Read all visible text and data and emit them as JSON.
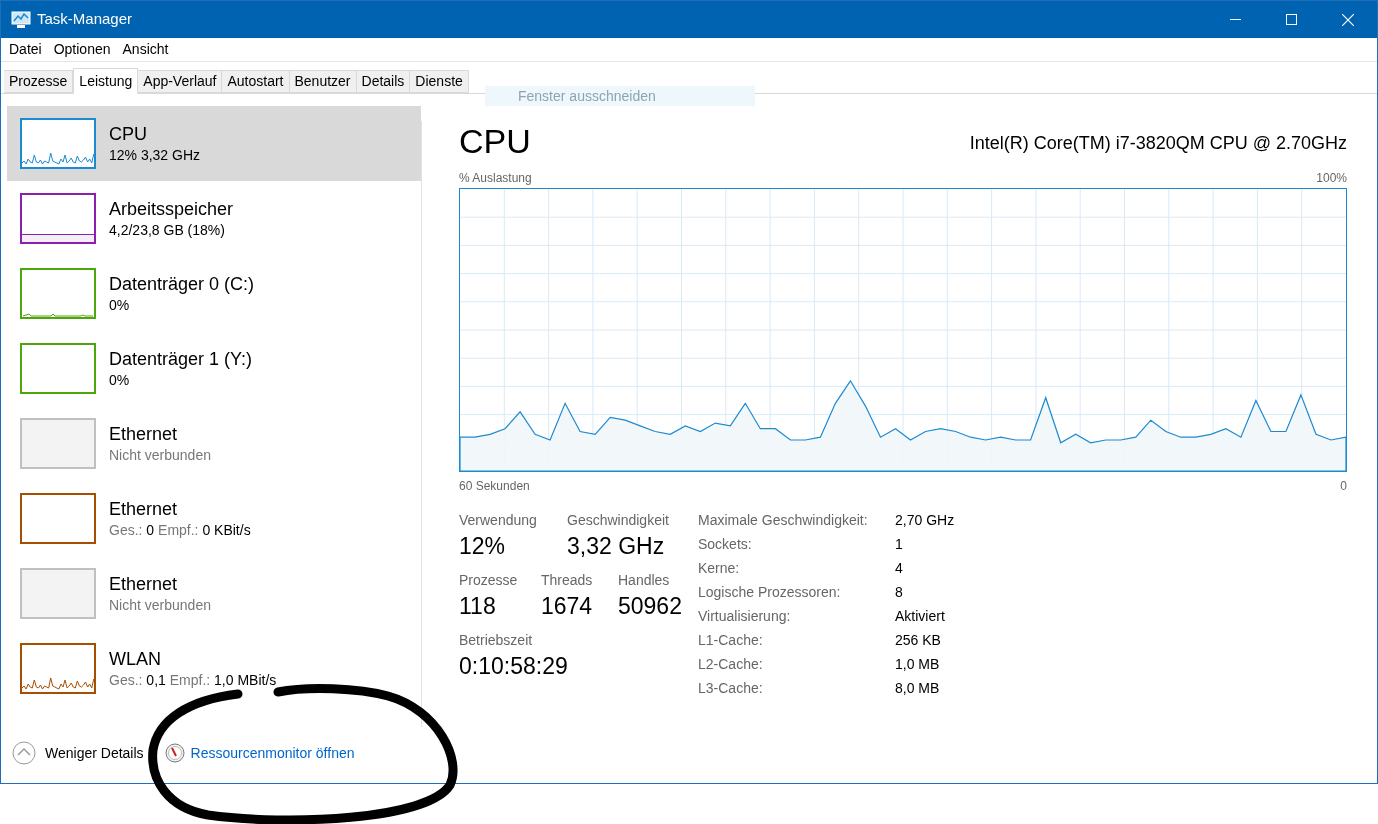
{
  "window": {
    "title": "Task-Manager"
  },
  "menu": [
    "Datei",
    "Optionen",
    "Ansicht"
  ],
  "tabs": [
    {
      "label": "Prozesse",
      "selected": false
    },
    {
      "label": "Leistung",
      "selected": true
    },
    {
      "label": "App-Verlauf",
      "selected": false
    },
    {
      "label": "Autostart",
      "selected": false
    },
    {
      "label": "Benutzer",
      "selected": false
    },
    {
      "label": "Details",
      "selected": false
    },
    {
      "label": "Dienste",
      "selected": false
    }
  ],
  "tooltip": "Fenster ausschneiden",
  "sidebar": {
    "items": [
      {
        "kind": "spark",
        "name": "CPU",
        "detail": "12%  3,32 GHz",
        "color": "#1c8ad0",
        "selected": true
      },
      {
        "kind": "fill",
        "name": "Arbeitsspeicher",
        "detail": "4,2/23,8 GB (18%)",
        "color": "#8b1fb0",
        "selected": false
      },
      {
        "kind": "flat",
        "name": "Datenträger 0 (C:)",
        "detail": "0%",
        "color": "#4da60c",
        "selected": false
      },
      {
        "kind": "empty",
        "name": "Datenträger 1 (Y:)",
        "detail": "0%",
        "color": "#4da60c",
        "selected": false
      },
      {
        "kind": "disconnected",
        "name": "Ethernet",
        "detail": "Nicht verbunden",
        "color": "#c0c0c0",
        "selected": false
      },
      {
        "kind": "empty",
        "name": "Ethernet",
        "detail_parts": [
          {
            "text": "Ges.:",
            "muted": true
          },
          {
            "text": "0",
            "muted": false
          },
          {
            "text": "Empf.:",
            "muted": true
          },
          {
            "text": "0 KBit/s",
            "muted": false
          }
        ],
        "color": "#a74f01",
        "selected": false
      },
      {
        "kind": "disconnected",
        "name": "Ethernet",
        "detail": "Nicht verbunden",
        "color": "#c0c0c0",
        "selected": false
      },
      {
        "kind": "spark",
        "name": "WLAN",
        "detail_parts": [
          {
            "text": "Ges.:",
            "muted": true
          },
          {
            "text": "0,1",
            "muted": false
          },
          {
            "text": "Empf.:",
            "muted": true
          },
          {
            "text": "1,0 MBit/s",
            "muted": false
          }
        ],
        "color": "#a74f01",
        "selected": false
      }
    ]
  },
  "main": {
    "title": "CPU",
    "model": "Intel(R) Core(TM) i7-3820QM CPU @ 2.70GHz",
    "graph": {
      "kind": "picture",
      "ylabel": "% Auslastung",
      "ymax_label": "100%",
      "x_start_label": "60 Sekunden",
      "x_end_label": "0"
    },
    "stat_rows": [
      [
        {
          "label": "Verwendung",
          "value": "12%"
        },
        {
          "label": "Geschwindigkeit",
          "value": "3,32 GHz"
        }
      ],
      [
        {
          "label": "Prozesse",
          "value": "118"
        },
        {
          "label": "Threads",
          "value": "1674"
        },
        {
          "label": "Handles",
          "value": "50962"
        }
      ],
      [
        {
          "label": "Betriebszeit",
          "value": "0:10:58:29"
        }
      ]
    ],
    "details": [
      {
        "label": "Maximale Geschwindigkeit:",
        "value": "2,70 GHz"
      },
      {
        "label": "Sockets:",
        "value": "1"
      },
      {
        "label": "Kerne:",
        "value": "4"
      },
      {
        "label": "Logische Prozessoren:",
        "value": "8"
      },
      {
        "label": "Virtualisierung:",
        "value": "Aktiviert"
      },
      {
        "label": "L1-Cache:",
        "value": "256 KB"
      },
      {
        "label": "L2-Cache:",
        "value": "1,0 MB"
      },
      {
        "label": "L3-Cache:",
        "value": "8,0 MB"
      }
    ]
  },
  "footer": {
    "fewer_details": "Weniger Details",
    "resource_monitor": "Ressourcenmonitor öffnen"
  }
}
